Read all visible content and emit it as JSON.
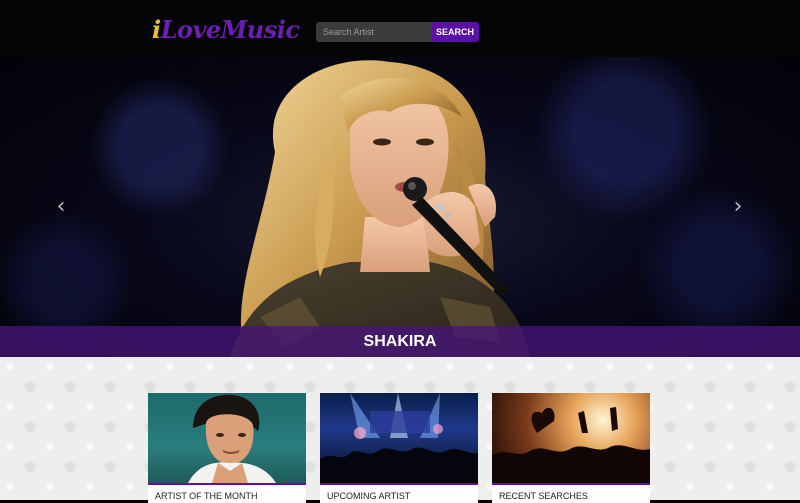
{
  "header": {
    "logo_i": "i",
    "logo_rest": "LoveMusic",
    "search_placeholder": "Search Artist",
    "search_button": "SEARCH"
  },
  "hero": {
    "caption": "SHAKIRA",
    "prev_icon": "chevron-left-icon",
    "next_icon": "chevron-right-icon"
  },
  "cards": [
    {
      "label": "ARTIST OF THE MONTH"
    },
    {
      "label": "UPCOMING ARTIST"
    },
    {
      "label": "RECENT SEARCHES"
    }
  ],
  "colors": {
    "accent": "#5b0ea8",
    "logo_gold": "#e9c233",
    "logo_purple": "#6a1fb0",
    "caption_bar": "#46147a"
  }
}
